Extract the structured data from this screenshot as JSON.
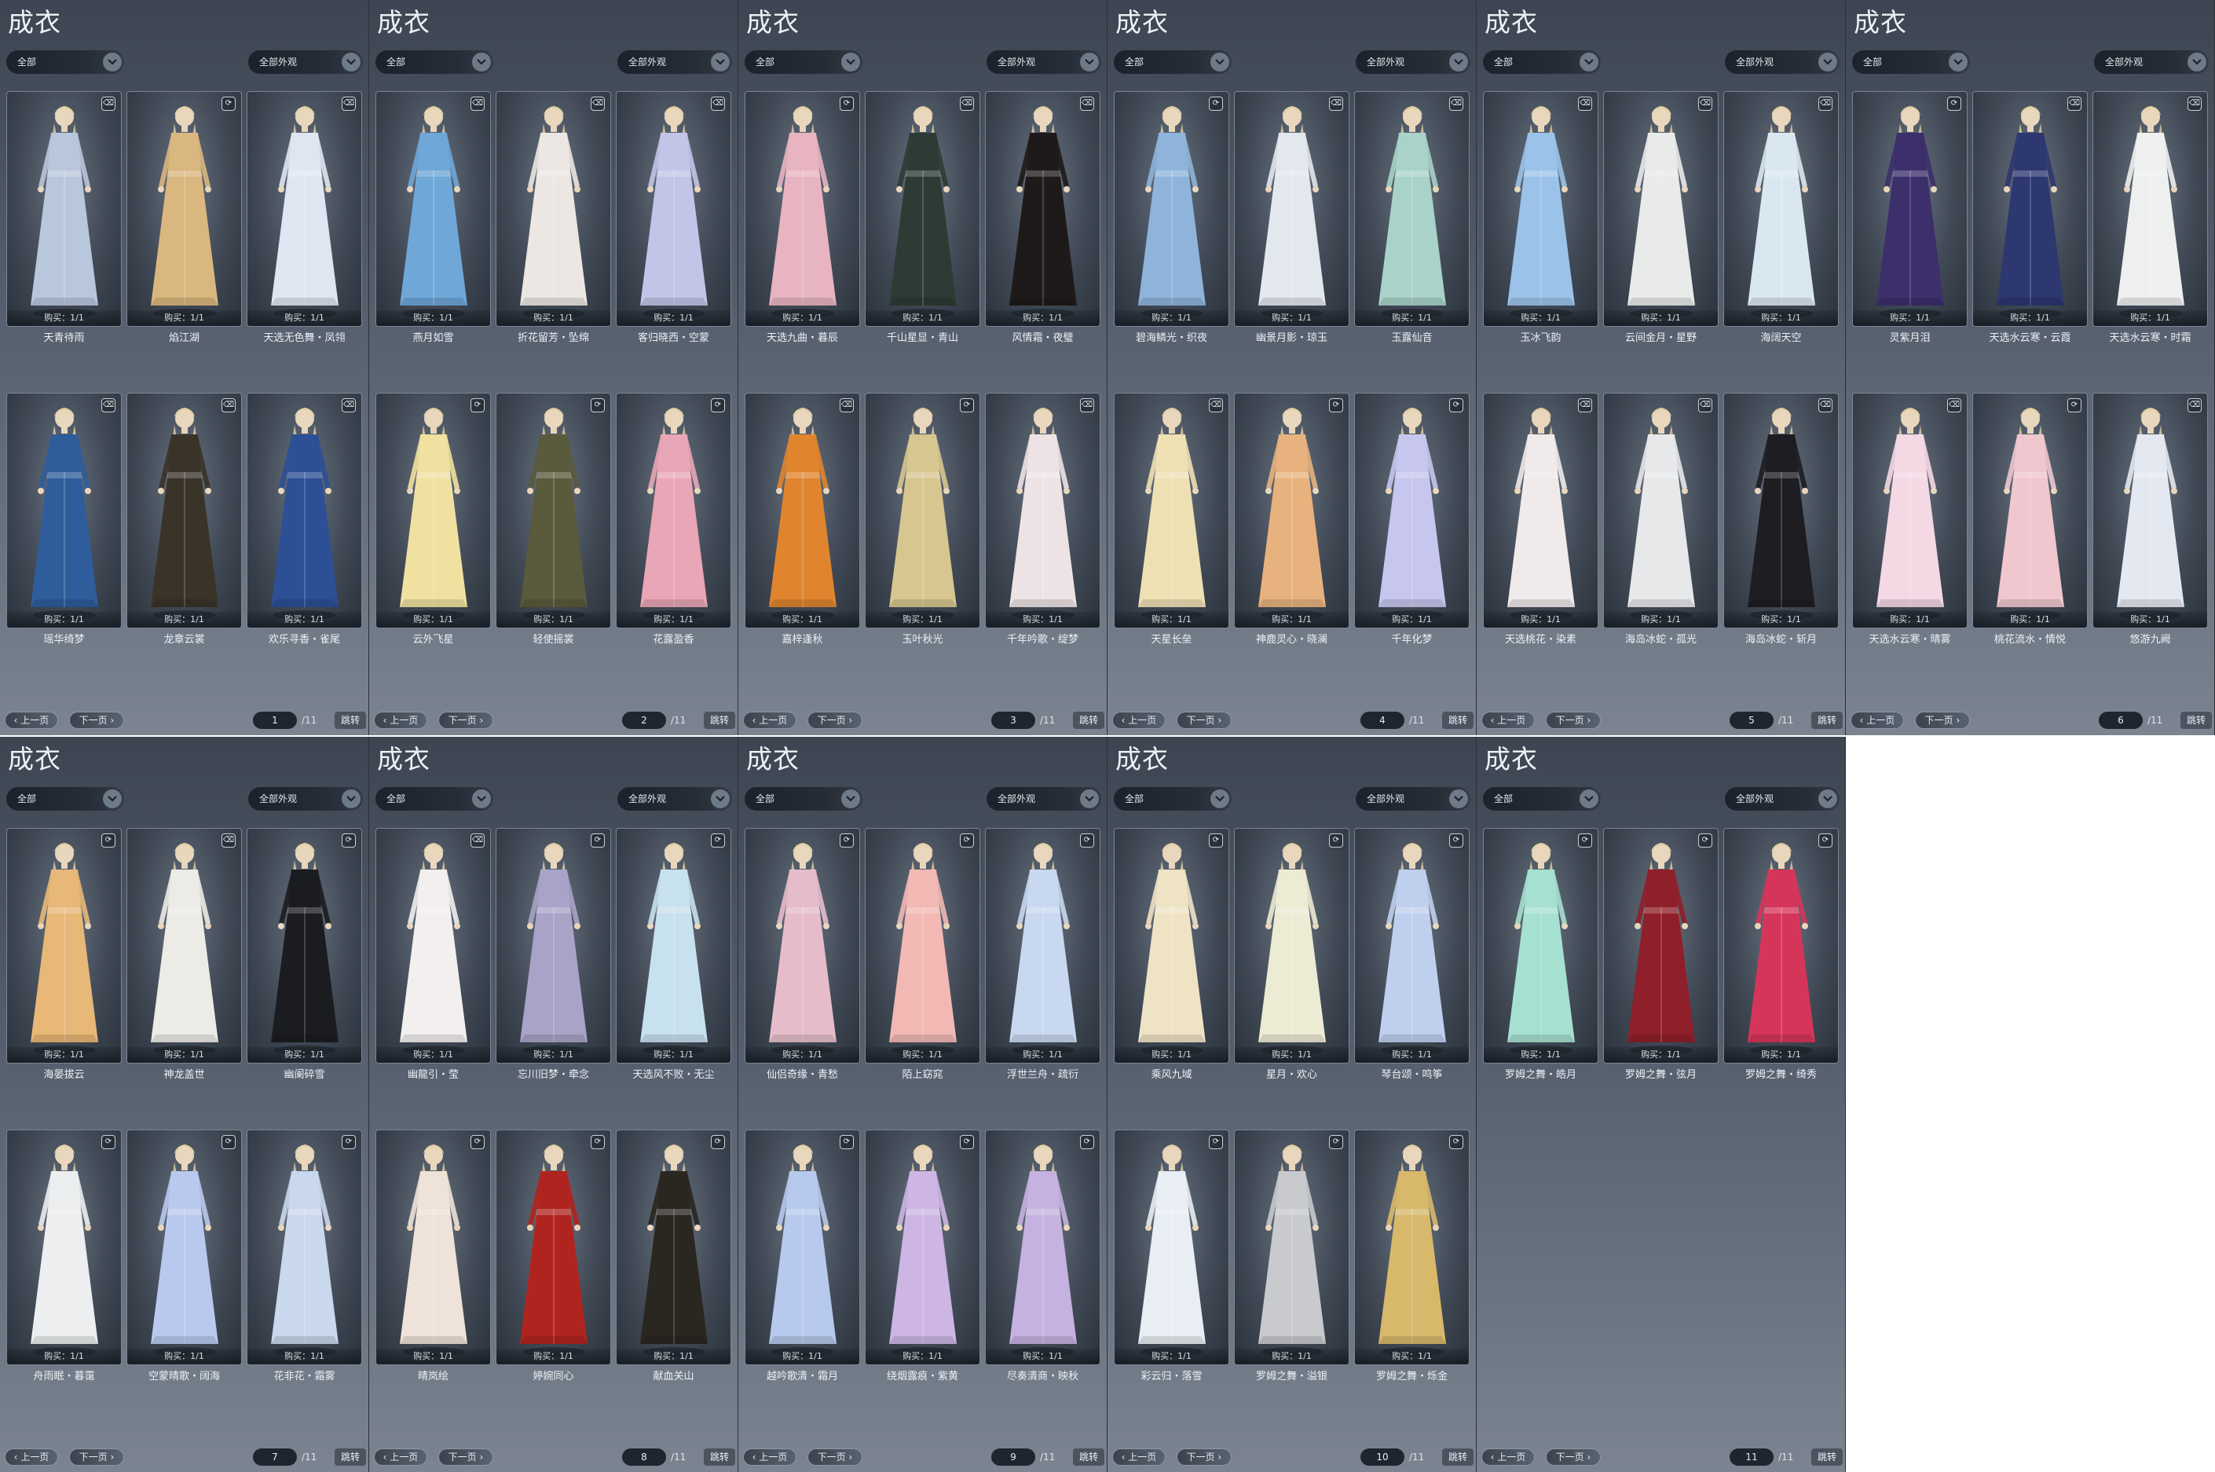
{
  "title": "成衣",
  "filter_category": "全部",
  "filter_appearance": "全部外观",
  "prev_label": "上一页",
  "next_label": "下一页",
  "jump_label": "跳转",
  "total_pages_label": "/11",
  "bought_label": "购买：1/1",
  "panels": [
    {
      "page": "1",
      "items": [
        {
          "name": "天青待雨",
          "icon": "trash-icon",
          "color": "#b9c7dc"
        },
        {
          "name": "焰江湖",
          "icon": "wardrobe-icon",
          "color": "#d9b77e"
        },
        {
          "name": "天选无色舞・凤翎",
          "icon": "trash-icon",
          "color": "#dfe6f2"
        },
        {
          "name": "瑶华绮梦",
          "icon": "trash-icon",
          "color": "#2f5d9c"
        },
        {
          "name": "龙章云裳",
          "icon": "trash-icon",
          "color": "#3a3328"
        },
        {
          "name": "欢乐寻香・雀尾",
          "icon": "trash-icon",
          "color": "#2c4f96"
        }
      ]
    },
    {
      "page": "2",
      "items": [
        {
          "name": "燕月如雪",
          "icon": "trash-icon",
          "color": "#6fa7d8"
        },
        {
          "name": "折花留芳・坠绵",
          "icon": "trash-icon",
          "color": "#ece7e2"
        },
        {
          "name": "客归晓西・空蒙",
          "icon": "trash-icon",
          "color": "#c2c4e8"
        },
        {
          "name": "云外飞星",
          "icon": "wardrobe-icon",
          "color": "#f0e1a0"
        },
        {
          "name": "轻使摇裳",
          "icon": "wardrobe-icon",
          "color": "#5a5a3c"
        },
        {
          "name": "花露盈香",
          "icon": "wardrobe-icon",
          "color": "#e9a6b6"
        }
      ]
    },
    {
      "page": "3",
      "items": [
        {
          "name": "天选九曲・暮辰",
          "icon": "wardrobe-icon",
          "color": "#e8b4c2"
        },
        {
          "name": "千山星显・青山",
          "icon": "trash-icon",
          "color": "#2c3c35"
        },
        {
          "name": "风情霜・夜璧",
          "icon": "trash-icon",
          "color": "#1e1a1a"
        },
        {
          "name": "嘉梓逢秋",
          "icon": "trash-icon",
          "color": "#e0852e"
        },
        {
          "name": "玉叶秋光",
          "icon": "wardrobe-icon",
          "color": "#d8c690"
        },
        {
          "name": "千年吟歌・绽梦",
          "icon": "trash-icon",
          "color": "#ede3e5"
        }
      ]
    },
    {
      "page": "4",
      "items": [
        {
          "name": "碧海鳞光・织夜",
          "icon": "wardrobe-icon",
          "color": "#8fb4dc"
        },
        {
          "name": "幽景月影・琼玉",
          "icon": "trash-icon",
          "color": "#e3e8ee"
        },
        {
          "name": "玉露仙音",
          "icon": "trash-icon",
          "color": "#a9d3c8"
        },
        {
          "name": "天星长垒",
          "icon": "trash-icon",
          "color": "#efe0b4"
        },
        {
          "name": "神鹿灵心・晓澜",
          "icon": "wardrobe-icon",
          "color": "#e8b27e"
        },
        {
          "name": "千年化梦",
          "icon": "wardrobe-icon",
          "color": "#c6c6ee"
        }
      ]
    },
    {
      "page": "5",
      "items": [
        {
          "name": "玉冰飞韵",
          "icon": "trash-icon",
          "color": "#9bc3ea"
        },
        {
          "name": "云间金月・星野",
          "icon": "trash-icon",
          "color": "#e9eaea"
        },
        {
          "name": "海阔天空",
          "icon": "trash-icon",
          "color": "#d9e8f0"
        },
        {
          "name": "天选桃花・染素",
          "icon": "trash-icon",
          "color": "#f0eaea"
        },
        {
          "name": "海岛冰蛇・孤光",
          "icon": "trash-icon",
          "color": "#e7e8ea"
        },
        {
          "name": "海岛冰蛇・斩月",
          "icon": "trash-icon",
          "color": "#1d1d22"
        }
      ]
    },
    {
      "page": "6",
      "items": [
        {
          "name": "灵紫月泪",
          "icon": "wardrobe-icon",
          "color": "#3c2f6c"
        },
        {
          "name": "天选水云寒・云霞",
          "icon": "trash-icon",
          "color": "#2d3770"
        },
        {
          "name": "天选水云寒・时霜",
          "icon": "trash-icon",
          "color": "#eef0f0"
        },
        {
          "name": "天选水云寒・晴雾",
          "icon": "trash-icon",
          "color": "#f4d8e4"
        },
        {
          "name": "桃花流水・情悦",
          "icon": "wardrobe-icon",
          "color": "#f0c6cf"
        },
        {
          "name": "悠游九阙",
          "icon": "trash-icon",
          "color": "#e4e8f0"
        }
      ]
    },
    {
      "page": "7",
      "items": [
        {
          "name": "海晏拔云",
          "icon": "wardrobe-icon",
          "color": "#e7b877"
        },
        {
          "name": "神龙盖世",
          "icon": "trash-icon",
          "color": "#ecebe6"
        },
        {
          "name": "幽阑碎雪",
          "icon": "wardrobe-icon",
          "color": "#1b1c20"
        },
        {
          "name": "舟雨眠・暮霭",
          "icon": "wardrobe-icon",
          "color": "#eceef0"
        },
        {
          "name": "空蒙晴歌・阔海",
          "icon": "wardrobe-icon",
          "color": "#b9c9ee"
        },
        {
          "name": "花非花・霜雾",
          "icon": "wardrobe-icon",
          "color": "#c9d8ec"
        }
      ]
    },
    {
      "page": "8",
      "items": [
        {
          "name": "幽龍引・莹",
          "icon": "trash-icon",
          "color": "#f2efee"
        },
        {
          "name": "忘川旧梦・牵念",
          "icon": "wardrobe-icon",
          "color": "#a9a3c8"
        },
        {
          "name": "天选风不败・无尘",
          "icon": "wardrobe-icon",
          "color": "#c8e1ee"
        },
        {
          "name": "晴岚绘",
          "icon": "wardrobe-icon",
          "color": "#efe2d8"
        },
        {
          "name": "婷婉同心",
          "icon": "wardrobe-icon",
          "color": "#b0241f"
        },
        {
          "name": "献血关山",
          "icon": "wardrobe-icon",
          "color": "#2a2620"
        }
      ]
    },
    {
      "page": "9",
      "items": [
        {
          "name": "仙侣奇缘・青愁",
          "icon": "wardrobe-icon",
          "color": "#e6bccb"
        },
        {
          "name": "陌上窈窕",
          "icon": "wardrobe-icon",
          "color": "#f2b9b4"
        },
        {
          "name": "浮世兰舟・疏衍",
          "icon": "wardrobe-icon",
          "color": "#c8d8f0"
        },
        {
          "name": "越吟歌清・霜月",
          "icon": "wardrobe-icon",
          "color": "#b7c9ec"
        },
        {
          "name": "绕烟露痕・紫黄",
          "icon": "wardrobe-icon",
          "color": "#cdb6e4"
        },
        {
          "name": "尽奏清商・映秋",
          "icon": "wardrobe-icon",
          "color": "#c6b2e0"
        }
      ]
    },
    {
      "page": "10",
      "items": [
        {
          "name": "乘风九域",
          "icon": "wardrobe-icon",
          "color": "#efe3c6"
        },
        {
          "name": "星月・欢心",
          "icon": "wardrobe-icon",
          "color": "#ecebd4"
        },
        {
          "name": "琴台颂・鸣筝",
          "icon": "wardrobe-icon",
          "color": "#bfd0ee"
        },
        {
          "name": "彩云归・落雪",
          "icon": "wardrobe-icon",
          "color": "#e9eef4"
        },
        {
          "name": "罗姆之舞・溢银",
          "icon": "wardrobe-icon",
          "color": "#c8cacd"
        },
        {
          "name": "罗姆之舞・烁金",
          "icon": "wardrobe-icon",
          "color": "#d8b86a"
        }
      ]
    },
    {
      "page": "11",
      "items": [
        {
          "name": "罗姆之舞・皓月",
          "icon": "wardrobe-icon",
          "color": "#a6e0d0"
        },
        {
          "name": "罗姆之舞・弦月",
          "icon": "wardrobe-icon",
          "color": "#8f1f2a"
        },
        {
          "name": "罗姆之舞・绮秀",
          "icon": "wardrobe-icon",
          "color": "#d6355a"
        }
      ]
    }
  ]
}
